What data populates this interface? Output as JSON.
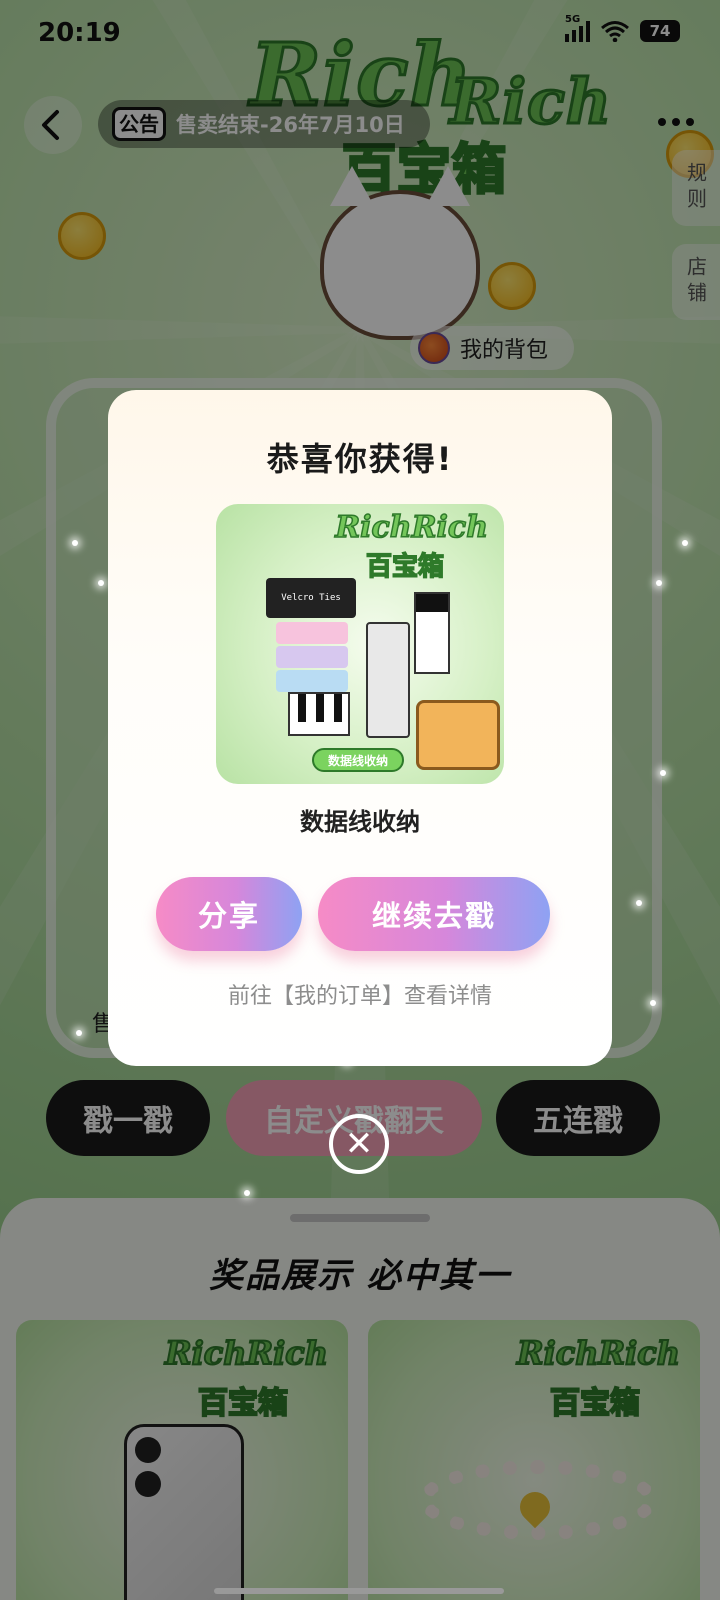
{
  "status_bar": {
    "time": "20:19",
    "network": "5G",
    "battery": "74"
  },
  "header": {
    "notice_tag": "公告",
    "notice_text": "售卖结束-26年7月10日"
  },
  "banner": {
    "word1": "Rich",
    "word2": "Rich",
    "word3": "百宝箱"
  },
  "side_tabs": {
    "rules": "规则",
    "shop": "店铺"
  },
  "backpack_label": "我的背包",
  "sold_text": "售",
  "action_buttons": {
    "single": "戳一戳",
    "custom": "自定义戳翻天",
    "five": "五连戳"
  },
  "prize_section": {
    "title": "奖品展示 必中其一",
    "cards": [
      {
        "logo": "RichRich",
        "logo_sub": "百宝箱",
        "item": "phone"
      },
      {
        "logo": "RichRich",
        "logo_sub": "百宝箱",
        "item": "bracelet"
      }
    ]
  },
  "modal": {
    "title": "恭喜你获得!",
    "image": {
      "logo": "RichRich",
      "logo_sub": "百宝箱",
      "packaging_text": "Velcro Ties",
      "label": "数据线收纳"
    },
    "prize_name": "数据线收纳",
    "share_label": "分享",
    "continue_label": "继续去戳",
    "order_link": "前往【我的订单】查看详情"
  },
  "colors": {
    "button_gradient_start": "#f68bc6",
    "button_gradient_end": "#8ea2f3",
    "brand_green": "#6cc455"
  },
  "icons": [
    "back-icon",
    "more-icon",
    "backpack-icon",
    "close-icon",
    "wifi-icon",
    "signal-icon",
    "battery-icon"
  ]
}
